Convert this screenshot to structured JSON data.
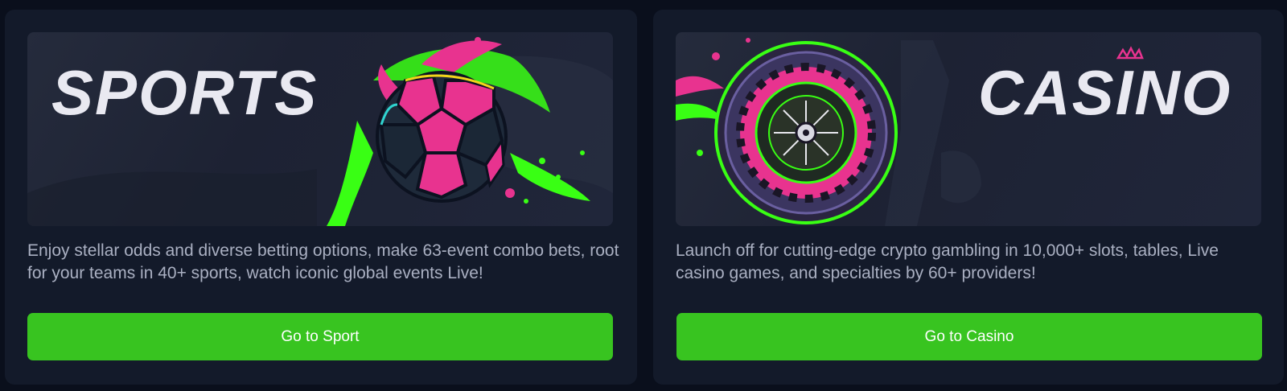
{
  "sport": {
    "banner_title": "SPORTS",
    "description": "Enjoy stellar odds and diverse betting options, make 63-event combo bets, root for your teams in 40+ sports, watch iconic global events Live!",
    "button_label": "Go to Sport"
  },
  "casino": {
    "banner_title": "CASINO",
    "description": "Launch off for cutting-edge crypto gambling in 10,000+ slots, tables, Live casino games, and specialties by 60+ providers!",
    "button_label": "Go to Casino"
  },
  "colors": {
    "page_bg": "#0a0f1c",
    "card_bg": "#131a2a",
    "button_green": "#38c420",
    "accent_pink": "#e8338f",
    "accent_neon_green": "#39ff14",
    "text_muted": "#aab0c2"
  },
  "icons": {
    "sport_art": "soccer-ball-icon",
    "casino_art": "roulette-wheel-icon",
    "crown": "crown-icon"
  }
}
